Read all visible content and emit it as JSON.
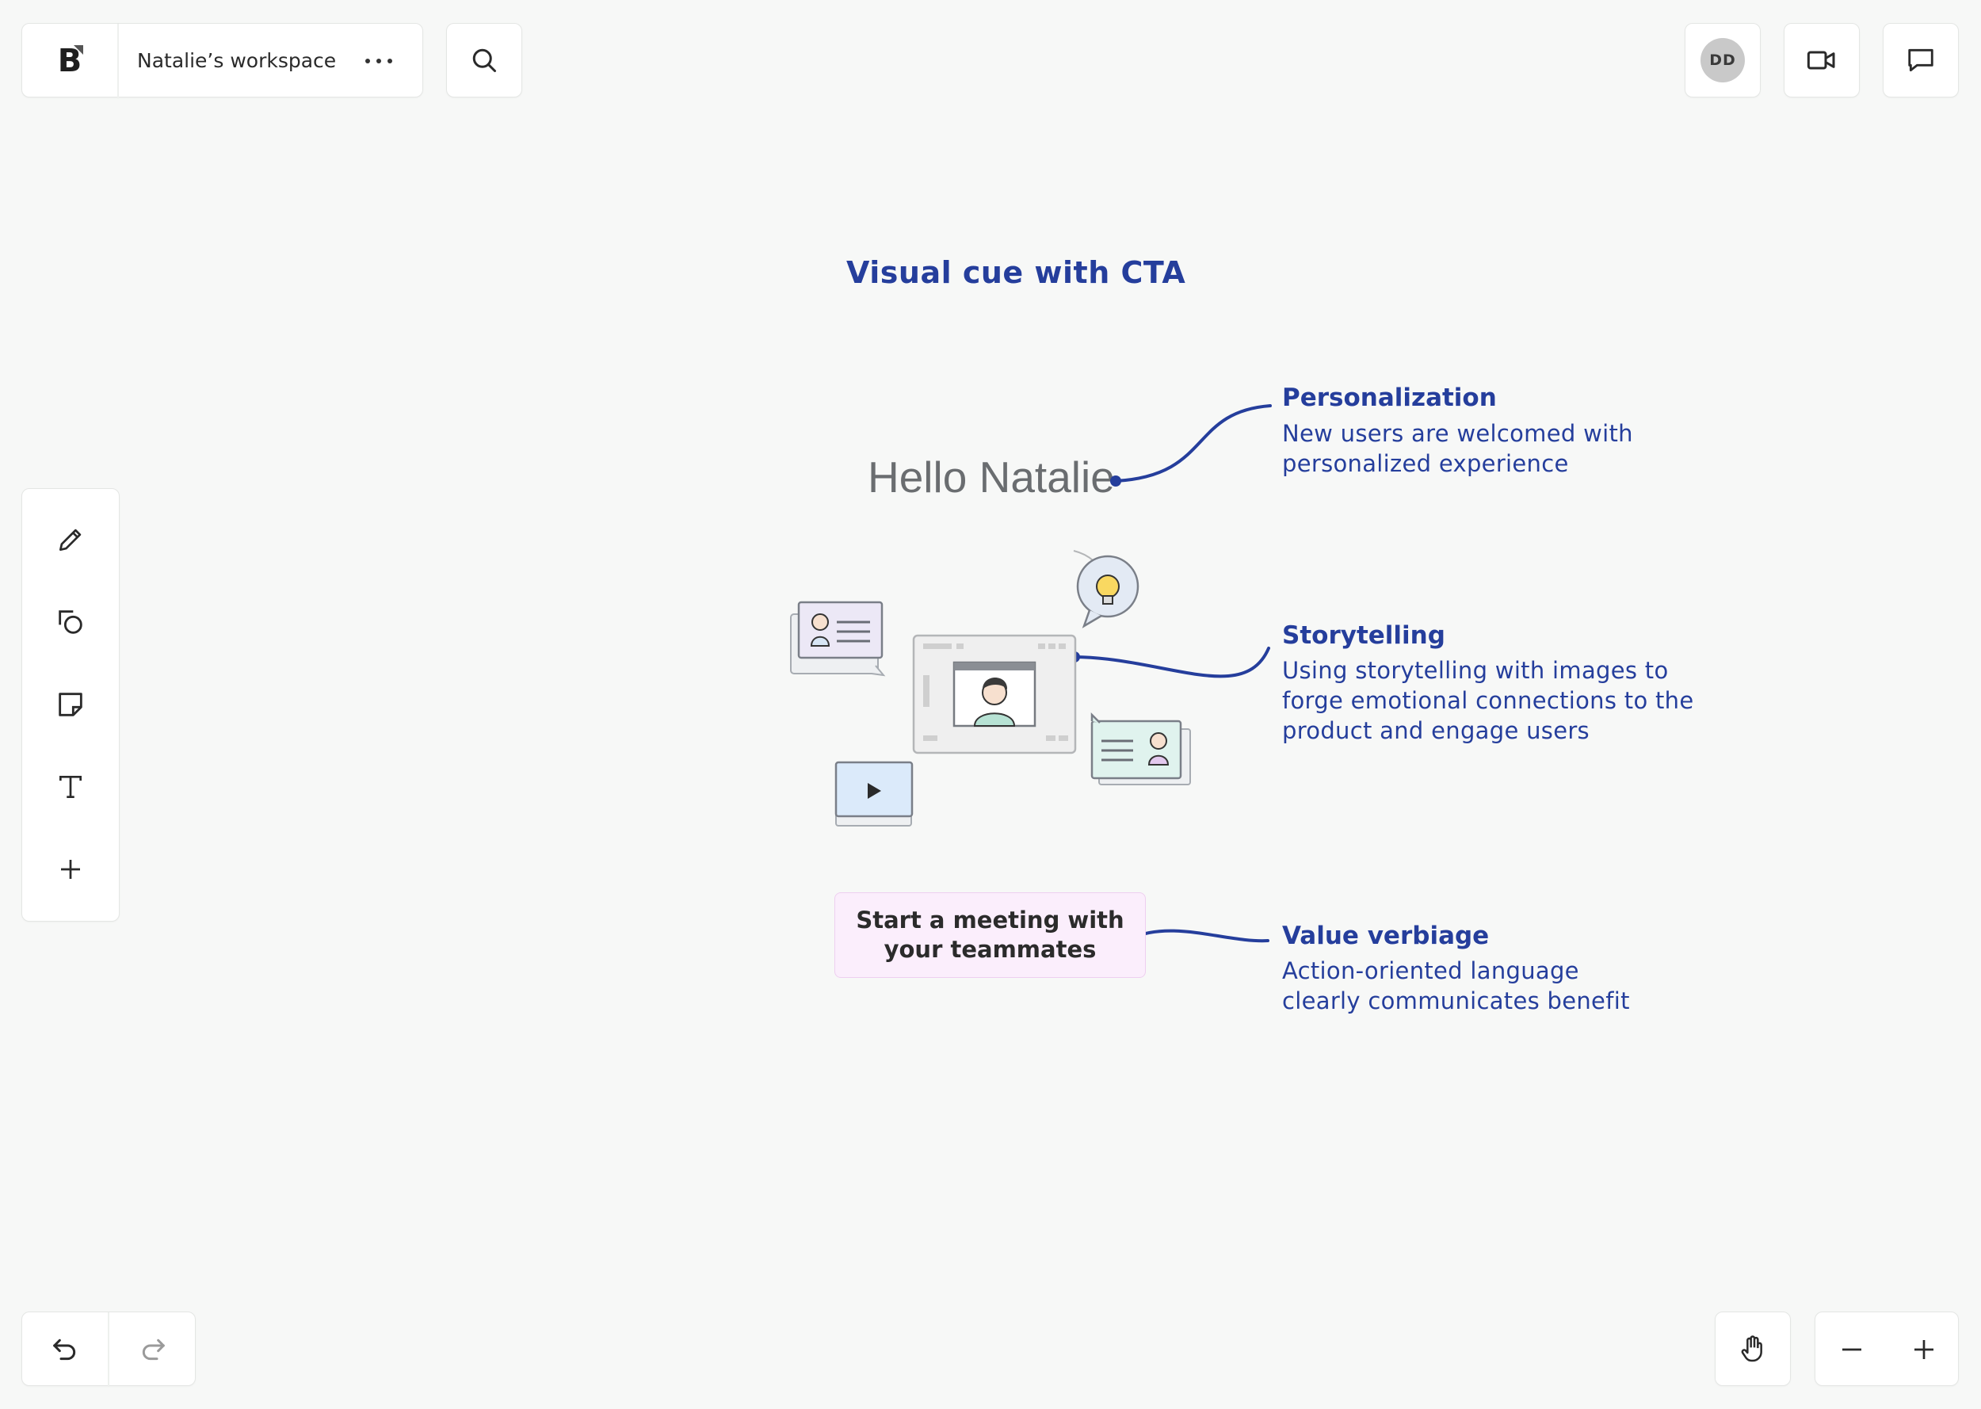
{
  "workspace": {
    "name": "Natalie’s workspace",
    "logo_letter": "B"
  },
  "user": {
    "initials": "DD"
  },
  "canvas": {
    "title": "Visual cue with CTA",
    "greeting": "Hello Natalie",
    "cta_label": "Start a meeting with\nyour teammates",
    "notes": [
      {
        "title": "Personalization",
        "body": "New users are welcomed with\npersonalized experience"
      },
      {
        "title": "Storytelling",
        "body": "Using storytelling with images to\nforge emotional connections to the\nproduct and engage users"
      },
      {
        "title": "Value verbiage",
        "body": "Action-oriented language\nclearly communicates benefit"
      }
    ]
  },
  "colors": {
    "annotation": "#253e9c",
    "cta_bg": "#fbeefc",
    "canvas_bg": "#f7f8f7"
  },
  "icons": {
    "toolbar": [
      "pencil-icon",
      "shapes-icon",
      "sticky-note-icon",
      "text-icon",
      "plus-icon"
    ],
    "top_right": [
      "avatar",
      "video-camera-icon",
      "comment-icon"
    ],
    "bottom": [
      "undo-icon",
      "redo-icon",
      "hand-icon",
      "zoom-out-icon",
      "zoom-in-icon"
    ]
  }
}
